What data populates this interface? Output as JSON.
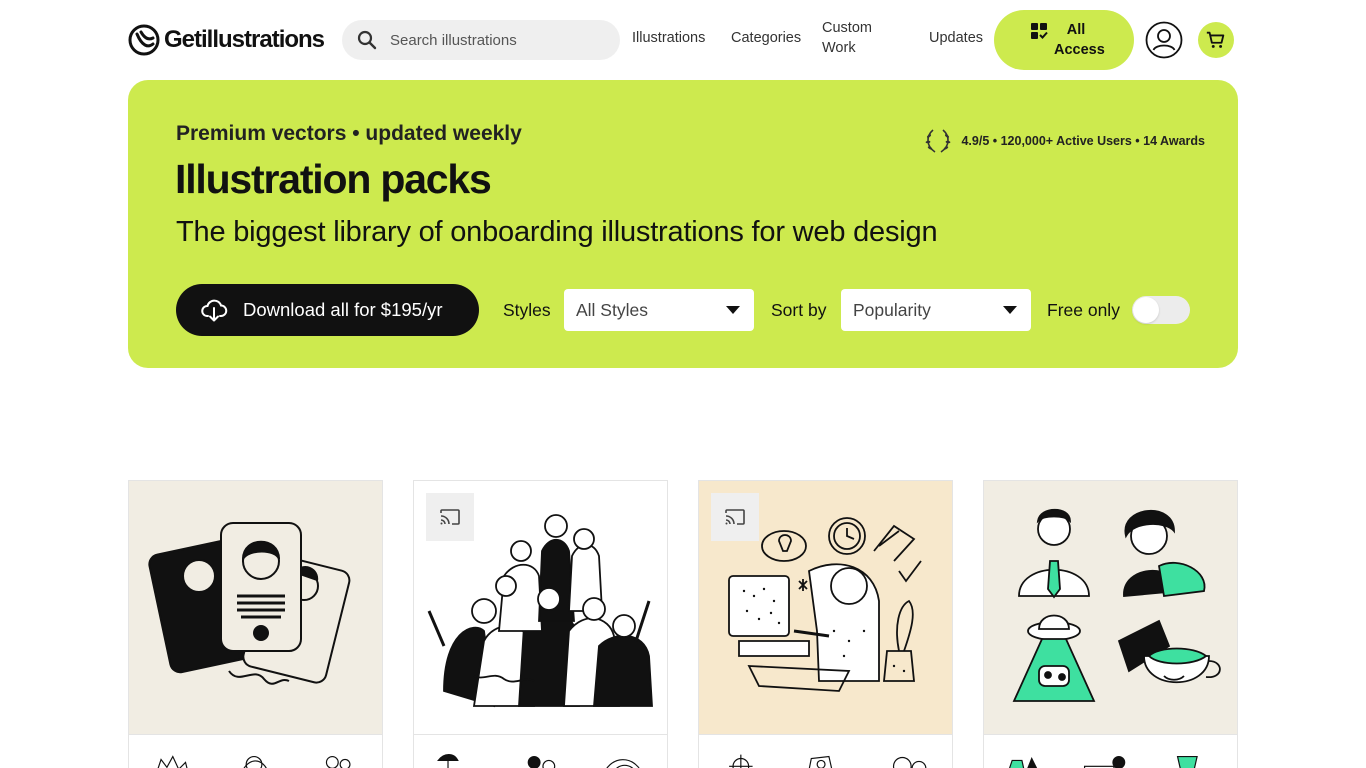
{
  "header": {
    "logo_text": "Getillustrations",
    "search_placeholder": "Search illustrations",
    "nav": {
      "illustrations": "Illustrations",
      "categories": "Categories",
      "custom_work": "Custom Work",
      "updates": "Updates"
    },
    "all_access_label": "All Access",
    "user_icon": "user-icon",
    "cart_icon": "cart-icon"
  },
  "hero": {
    "eyebrow": "Premium vectors • updated weekly",
    "title": "Illustration packs",
    "subtitle": "The biggest library of onboarding illustrations for web design",
    "rating": "4.9/5 • 120,000+ Active Users • 14 Awards",
    "download_label": "Download all for $195/yr",
    "styles_label": "Styles",
    "styles_value": "All Styles",
    "sort_label": "Sort by",
    "sort_value": "Popularity",
    "free_label": "Free only",
    "free_only": false
  },
  "cards": [
    {
      "background": "#f1ede3",
      "has_cast_badge": false
    },
    {
      "background": "#ffffff",
      "has_cast_badge": true
    },
    {
      "background": "#f7e8cc",
      "has_cast_badge": true
    },
    {
      "background": "#f1ede3",
      "has_cast_badge": false
    }
  ],
  "colors": {
    "accent": "#cdea4e",
    "dark": "#111111",
    "mint": "#3ee0a0"
  }
}
